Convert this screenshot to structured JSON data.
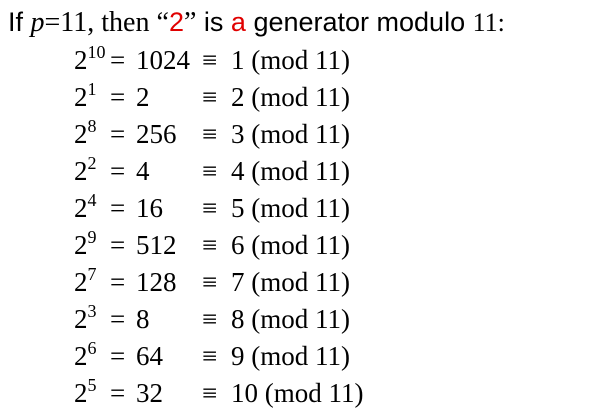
{
  "title": {
    "prefix": "If ",
    "var": "p",
    "assign": "=11",
    "comma": ", then ",
    "quote_open": "“",
    "generator": "2",
    "quote_close": "”",
    "is_word": " is ",
    "article": "a",
    "rest": " generator modulo ",
    "modulus": "11:"
  },
  "colors": {
    "accent": "#e00000",
    "text": "#000000"
  },
  "rows": [
    {
      "base": "2",
      "exp": "10",
      "eq": "=",
      "value": "1024",
      "cong": "≡",
      "result": "1 (mod 11)"
    },
    {
      "base": "2",
      "exp": "1",
      "eq": "=",
      "value": "2",
      "cong": "≡",
      "result": "2 (mod 11)"
    },
    {
      "base": "2",
      "exp": "8",
      "eq": "=",
      "value": "256",
      "cong": "≡",
      "result": "3 (mod 11)"
    },
    {
      "base": "2",
      "exp": "2",
      "eq": "=",
      "value": "4",
      "cong": "≡",
      "result": "4 (mod 11)"
    },
    {
      "base": "2",
      "exp": "4",
      "eq": "=",
      "value": "16",
      "cong": "≡",
      "result": "5 (mod 11)"
    },
    {
      "base": "2",
      "exp": "9",
      "eq": "=",
      "value": "512",
      "cong": "≡",
      "result": "6 (mod 11)"
    },
    {
      "base": "2",
      "exp": "7",
      "eq": "=",
      "value": "128",
      "cong": "≡",
      "result": "7 (mod 11)"
    },
    {
      "base": "2",
      "exp": "3",
      "eq": "=",
      "value": "8",
      "cong": "≡",
      "result": "8 (mod 11)"
    },
    {
      "base": "2",
      "exp": "6",
      "eq": "=",
      "value": "64",
      "cong": "≡",
      "result": "9 (mod 11)"
    },
    {
      "base": "2",
      "exp": "5",
      "eq": "=",
      "value": "32",
      "cong": "≡",
      "result": "10 (mod 11)"
    }
  ]
}
